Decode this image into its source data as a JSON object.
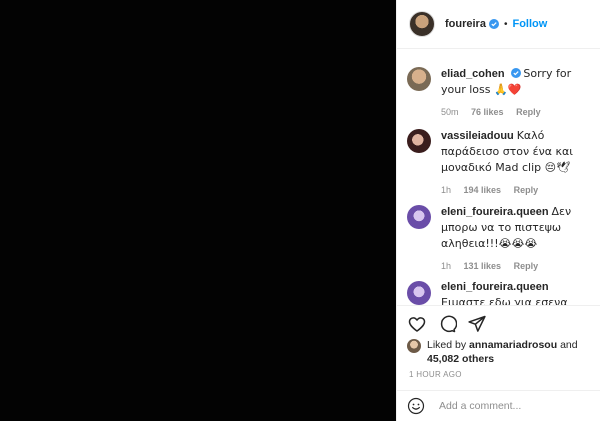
{
  "post": {
    "account": "foureira",
    "dot": "•",
    "follow_label": "Follow"
  },
  "comments": [
    {
      "user": "eliad_cohen",
      "verified": true,
      "text": "Sorry for your loss 🙏❤️",
      "time": "50m",
      "likes": "76 likes",
      "reply": "Reply"
    },
    {
      "user": "vassileiadouu",
      "verified": false,
      "text": "Καλό παράδεισο στον ένα και μοναδικό Mad clip 😔🕊",
      "time": "1h",
      "likes": "194 likes",
      "reply": "Reply"
    },
    {
      "user": "eleni_foureira.queen",
      "verified": false,
      "text": "Δεν μπορω να το πιστεψω αληθεια!!!😭😭😭",
      "time": "1h",
      "likes": "131 likes",
      "reply": "Reply"
    },
    {
      "user": "eleni_foureira.queen",
      "verified": false,
      "text": "Ειμαστε εδω για εσενα Ελενη!! Για να σε",
      "time": "",
      "likes": "",
      "reply": ""
    }
  ],
  "likes": {
    "prefix": "Liked by",
    "user": "annamariadrosou",
    "and": "and",
    "count": "45,082 others"
  },
  "time_ago": "1 HOUR AGO",
  "add_comment": {
    "placeholder": "Add a comment..."
  },
  "colors": {
    "follow": "#0095f6",
    "verified": "#3897f0",
    "meta": "#8e8e8e"
  }
}
